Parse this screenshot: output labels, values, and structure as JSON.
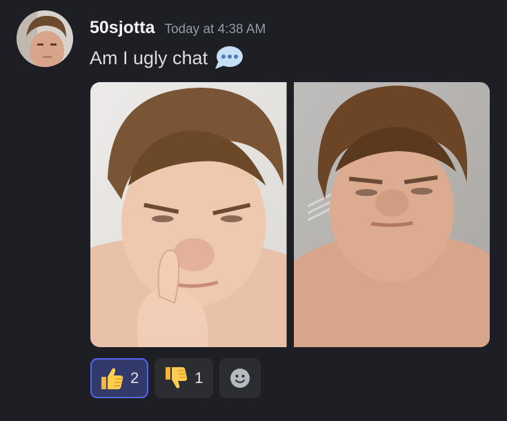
{
  "message": {
    "username": "50sjotta",
    "timestamp": "Today at 4:38 AM",
    "text": "Am I ugly chat",
    "text_emoji": "speech-balloon-icon"
  },
  "attachments": [
    {
      "name": "photo-1"
    },
    {
      "name": "photo-2"
    }
  ],
  "reactions": [
    {
      "emoji": "thumbs-up-icon",
      "count": "2",
      "selected": true
    },
    {
      "emoji": "thumbs-down-icon",
      "count": "1",
      "selected": false
    }
  ],
  "colors": {
    "background": "#1e1f25",
    "username": "#f2f3f5",
    "timestamp": "#949ba4",
    "selected_reaction_border": "#5865f2",
    "selected_reaction_bg": "#313a6b",
    "reaction_bg": "#2b2d31"
  }
}
